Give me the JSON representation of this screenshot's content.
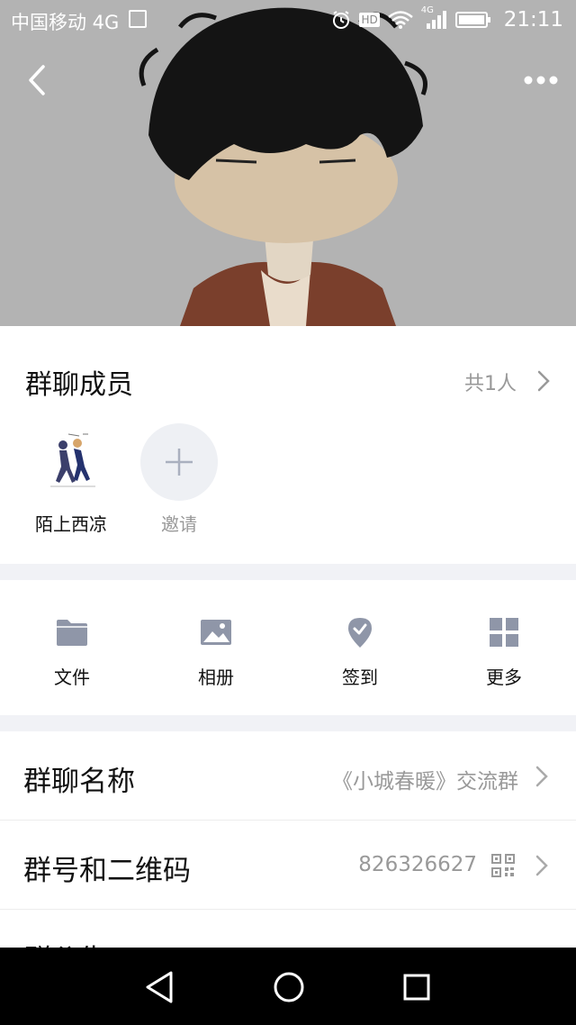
{
  "status_bar": {
    "carrier": "中国移动 4G",
    "hd_label": "HD",
    "network_label": "4G",
    "time": "21:11"
  },
  "colors": {
    "cover_background": "#b2b2b2",
    "accent_icon": "#8f96a8",
    "secondary_text": "#999999",
    "section_gap": "#f1f2f6"
  },
  "members": {
    "title": "群聊成员",
    "count_label": "共1人",
    "list": [
      {
        "name": "陌上西凉"
      }
    ],
    "invite_label": "邀请"
  },
  "actions": [
    {
      "label": "文件",
      "icon": "folder-icon"
    },
    {
      "label": "相册",
      "icon": "image-icon"
    },
    {
      "label": "签到",
      "icon": "check-in-icon"
    },
    {
      "label": "更多",
      "icon": "grid-icon"
    }
  ],
  "settings": {
    "group_name": {
      "label": "群聊名称",
      "value": "《小城春暖》交流群"
    },
    "group_number": {
      "label": "群号和二维码",
      "value": "826326627"
    },
    "group_notice": {
      "label": "群公告"
    }
  }
}
